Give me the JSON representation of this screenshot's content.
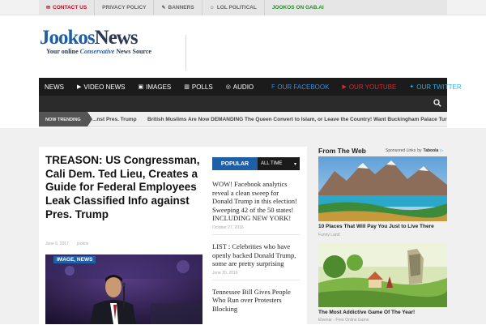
{
  "topbar": {
    "items": [
      {
        "label": "CONTACT US",
        "icon": "envelope-icon"
      },
      {
        "label": "PRIVACY POLICY",
        "icon": ""
      },
      {
        "label": "BANNERS",
        "icon": "pencil-icon"
      },
      {
        "label": "LOL POLITICAL",
        "icon": "smiley-icon"
      },
      {
        "label": "JOOKOS ON GAB.AI",
        "icon": ""
      }
    ]
  },
  "logo": {
    "part_a": "Jookos",
    "part_b": "News",
    "tagline_pre": "Your online ",
    "tagline_em": "Conservative",
    "tagline_post": " News Source"
  },
  "nav": {
    "items": [
      {
        "label": "NEWS",
        "icon": ""
      },
      {
        "label": "VIDEO NEWS",
        "icon": "video-icon"
      },
      {
        "label": "IMAGES",
        "icon": "image-icon"
      },
      {
        "label": "POLLS",
        "icon": "bar-chart-icon"
      },
      {
        "label": "AUDIO",
        "icon": "audio-icon"
      },
      {
        "label": "OUR FACEBOOK",
        "icon": "facebook-icon"
      },
      {
        "label": "OUR YOUTUBE",
        "icon": "youtube-icon"
      },
      {
        "label": "OUR TWITTER",
        "icon": "twitter-icon"
      }
    ]
  },
  "trending": {
    "label": "NOW TRENDING",
    "item_a": "...nst Pres. Trump",
    "item_b": "British Muslims Are Now DEMANDING The Queen Convert to Islam, or Leave the Country! Want Buckingham Palace Turned"
  },
  "article": {
    "headline": "TREASON: US Congressman, Cali Dem. Ted Lieu, Creates a Guide for Federal Employees Leak Classified Info against Pres. Trump",
    "date": "June 6, 2017",
    "author": "jookos",
    "tags": "IMAGE, NEWS"
  },
  "popular": {
    "tab_label": "POPULAR",
    "select_value": "ALL TIME",
    "items": [
      {
        "title": "WOW! Facebook analytics reveal a clean sweep for Donald Trump in this election! Sweeping 42 of the 50 states! INCLUDING NEW YORK!",
        "date": "October 27, 2016"
      },
      {
        "title": "LIST : Celebrities who have openly backed Donald Trump, some are pretty surprising",
        "date": "June 20, 2016"
      },
      {
        "title": "Tennessee Bill Gives People Who Run over Protesters Blocking",
        "date": ""
      }
    ]
  },
  "sidebar": {
    "heading": "From The Web",
    "sponsored": "Sponsored Links",
    "by": "by",
    "taboola": "Taboola",
    "ads": [
      {
        "title": "10 Places That Will Pay You Just to Live There",
        "source": "Funny Land"
      },
      {
        "title": "The Most Addictive Game Of The Year!",
        "source": "Elvenar - Free Online Game"
      }
    ]
  },
  "colors": {
    "brand_blue": "#1f5fa8",
    "nav_bg": "#1b1b1b",
    "facebook": "#3b8de0",
    "youtube": "#e0262c",
    "twitter": "#1fb3e8",
    "contact_red": "#d0021b",
    "gab_green": "#2a8a2a"
  }
}
